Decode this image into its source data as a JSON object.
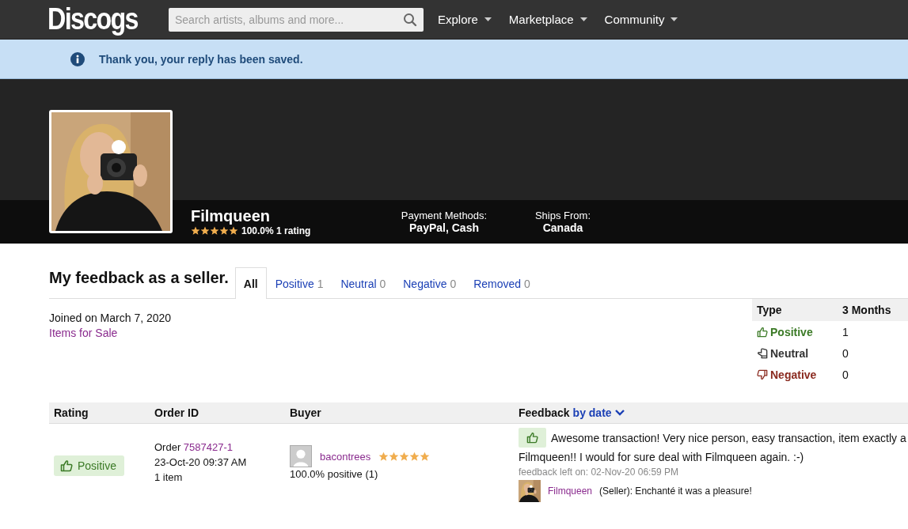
{
  "header": {
    "logo": "Discogs",
    "search": {
      "placeholder": "Search artists, albums and more..."
    },
    "nav": [
      "Explore",
      "Marketplace",
      "Community"
    ]
  },
  "notice": {
    "text": "Thank you, your reply has been saved."
  },
  "profile": {
    "name": "Filmqueen",
    "stars": 5,
    "rating": "100.0% 1 rating",
    "payment_label": "Payment Methods:",
    "payment": "PayPal, Cash",
    "ships_label": "Ships From:",
    "ships": "Canada"
  },
  "feedback": {
    "title": "My feedback as a seller.",
    "tabs": [
      {
        "label": "All",
        "selected": true
      },
      {
        "label": "Positive",
        "count": "1",
        "selected": false
      },
      {
        "label": "Neutral",
        "count": "0",
        "selected": false
      },
      {
        "label": "Negative",
        "count": "0",
        "selected": false
      },
      {
        "label": "Removed",
        "count": "0",
        "selected": false
      }
    ],
    "joined": "Joined on March 7, 2020",
    "items_link": "Items for Sale",
    "summary": {
      "columns": [
        "Type",
        "3 Months"
      ],
      "rows": [
        {
          "kind": "positive",
          "type": "Positive",
          "count": "1"
        },
        {
          "kind": "neutral",
          "type": "Neutral",
          "count": "0"
        },
        {
          "kind": "negative",
          "type": "Negative",
          "count": "0"
        }
      ]
    },
    "table": {
      "columns": [
        "Rating",
        "Order ID",
        "Buyer",
        "Feedback"
      ],
      "sort": "by date",
      "rows": [
        {
          "rating": {
            "kind": "positive",
            "label": "Positive"
          },
          "order_label": "Order",
          "order_id": "7587427-1",
          "date": "23-Oct-20 09:37 AM",
          "items": "1 item",
          "buyer": {
            "name": "bacontrees",
            "stars": 5,
            "score": "100.0% positive (1)"
          },
          "feedback_lines": [
            "Awesome transaction! Very nice person, easy transaction, item exactly a",
            "Filmqueen!! I would for sure deal with Filmqueen again. :-)"
          ],
          "left_on": "feedback left on: 02-Nov-20 06:59 PM",
          "reply": {
            "author": "Filmqueen",
            "text": "(Seller): Enchanté it was a pleasure!"
          }
        }
      ]
    }
  }
}
